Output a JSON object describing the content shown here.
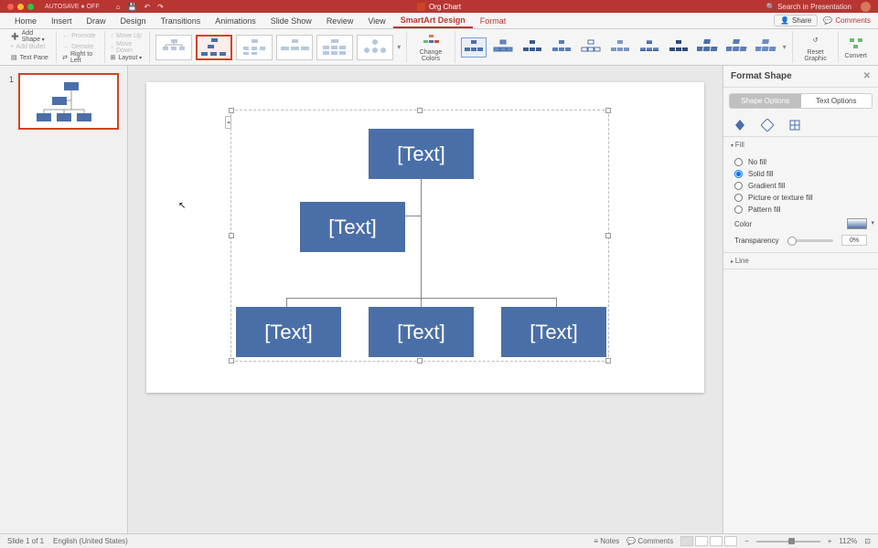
{
  "title_bar": {
    "autosave": "AUTOSAVE ● OFF",
    "doc_title": "Org Chart",
    "search_placeholder": "Search in Presentation"
  },
  "tabs": [
    "Home",
    "Insert",
    "Draw",
    "Design",
    "Transitions",
    "Animations",
    "Slide Show",
    "Review",
    "View",
    "SmartArt Design",
    "Format"
  ],
  "active_tab": "SmartArt Design",
  "share_label": "Share",
  "comments_label": "Comments",
  "ribbon": {
    "add_shape": "Add Shape",
    "add_bullet": "Add Bullet",
    "text_pane": "Text Pane",
    "promote": "Promote",
    "demote": "Demote",
    "right_to_left": "Right to Left",
    "move_up": "Move Up",
    "move_down": "Move Down",
    "layout": "Layout",
    "change_colors": "Change Colors",
    "reset_graphic": "Reset Graphic",
    "convert": "Convert"
  },
  "slide_number": "1",
  "org_chart": {
    "nodes": [
      "[Text]",
      "[Text]",
      "[Text]",
      "[Text]",
      "[Text]"
    ]
  },
  "format_pane": {
    "title": "Format Shape",
    "tab_shape": "Shape Options",
    "tab_text": "Text Options",
    "section_fill": "Fill",
    "section_line": "Line",
    "fill_options": [
      "No fill",
      "Solid fill",
      "Gradient fill",
      "Picture or texture fill",
      "Pattern fill"
    ],
    "selected_fill": "Solid fill",
    "color_label": "Color",
    "transparency_label": "Transparency",
    "transparency_value": "0%"
  },
  "status": {
    "slide_info": "Slide 1 of 1",
    "language": "English (United States)",
    "notes": "Notes",
    "comments": "Comments",
    "zoom": "112%"
  }
}
